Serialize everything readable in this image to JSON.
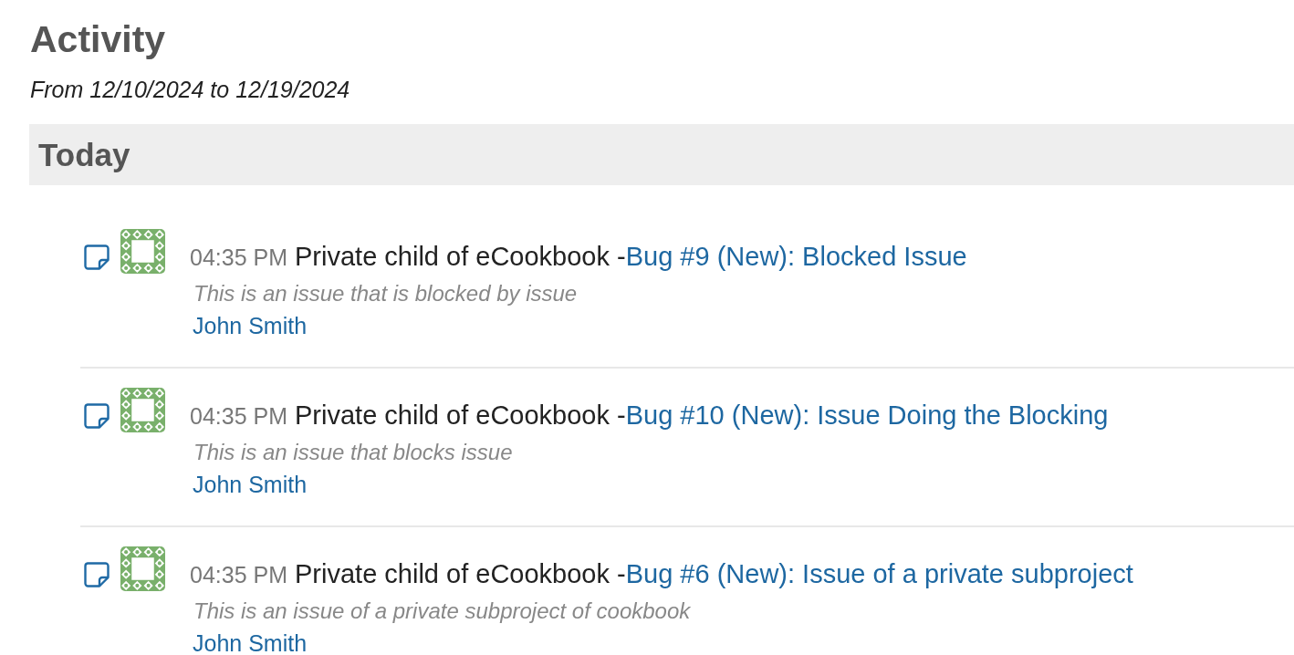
{
  "title": "Activity",
  "subtitle": "From 12/10/2024 to 12/19/2024",
  "days": [
    {
      "heading": "Today",
      "events": [
        {
          "time": "04:35 PM",
          "project": "Private child of eCookbook -",
          "link": "Bug #9 (New): Blocked Issue",
          "description": "This is an issue that is blocked by issue",
          "author": "John Smith"
        },
        {
          "time": "04:35 PM",
          "project": "Private child of eCookbook -",
          "link": "Bug #10 (New): Issue Doing the Blocking",
          "description": "This is an issue that blocks issue",
          "author": "John Smith"
        },
        {
          "time": "04:35 PM",
          "project": "Private child of eCookbook -",
          "link": "Bug #6 (New): Issue of a private subproject",
          "description": "This is an issue of a private subproject of cookbook",
          "author": "John Smith"
        }
      ]
    }
  ]
}
